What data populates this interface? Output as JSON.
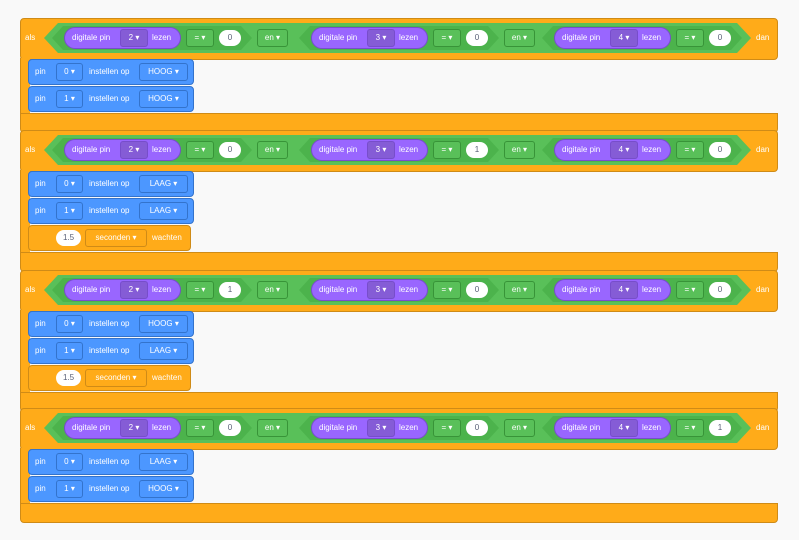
{
  "labels": {
    "if": "als",
    "then": "dan",
    "and": "en ▾",
    "read_prefix": "digitale pin",
    "read_suffix": "lezen",
    "op": "= ▾",
    "pin": "pin",
    "set": "instellen op",
    "wait_unit": "seconden ▾",
    "wait": "wachten"
  },
  "colors": {
    "control": "#ffab19",
    "operator": "#59c059",
    "extension": "#9966ff",
    "motion": "#4c97ff"
  },
  "blocks": [
    {
      "conditions": [
        {
          "pin": "2 ▾",
          "value": "0"
        },
        {
          "pin": "3 ▾",
          "value": "0"
        },
        {
          "pin": "4 ▾",
          "value": "0"
        }
      ],
      "statements": [
        {
          "type": "set",
          "pin": "0 ▾",
          "state": "HOOG ▾"
        },
        {
          "type": "set",
          "pin": "1 ▾",
          "state": "HOOG ▾"
        }
      ]
    },
    {
      "conditions": [
        {
          "pin": "2 ▾",
          "value": "0"
        },
        {
          "pin": "3 ▾",
          "value": "1"
        },
        {
          "pin": "4 ▾",
          "value": "0"
        }
      ],
      "statements": [
        {
          "type": "set",
          "pin": "0 ▾",
          "state": "LAAG ▾"
        },
        {
          "type": "set",
          "pin": "1 ▾",
          "state": "LAAG ▾"
        },
        {
          "type": "wait",
          "value": "1.5"
        }
      ]
    },
    {
      "conditions": [
        {
          "pin": "2 ▾",
          "value": "1"
        },
        {
          "pin": "3 ▾",
          "value": "0"
        },
        {
          "pin": "4 ▾",
          "value": "0"
        }
      ],
      "statements": [
        {
          "type": "set",
          "pin": "0 ▾",
          "state": "HOOG ▾"
        },
        {
          "type": "set",
          "pin": "1 ▾",
          "state": "LAAG ▾"
        },
        {
          "type": "wait",
          "value": "1.5"
        }
      ]
    },
    {
      "conditions": [
        {
          "pin": "2 ▾",
          "value": "0"
        },
        {
          "pin": "3 ▾",
          "value": "0"
        },
        {
          "pin": "4 ▾",
          "value": "1"
        }
      ],
      "statements": [
        {
          "type": "set",
          "pin": "0 ▾",
          "state": "LAAG ▾"
        },
        {
          "type": "set",
          "pin": "1 ▾",
          "state": "HOOG ▾"
        }
      ]
    }
  ]
}
